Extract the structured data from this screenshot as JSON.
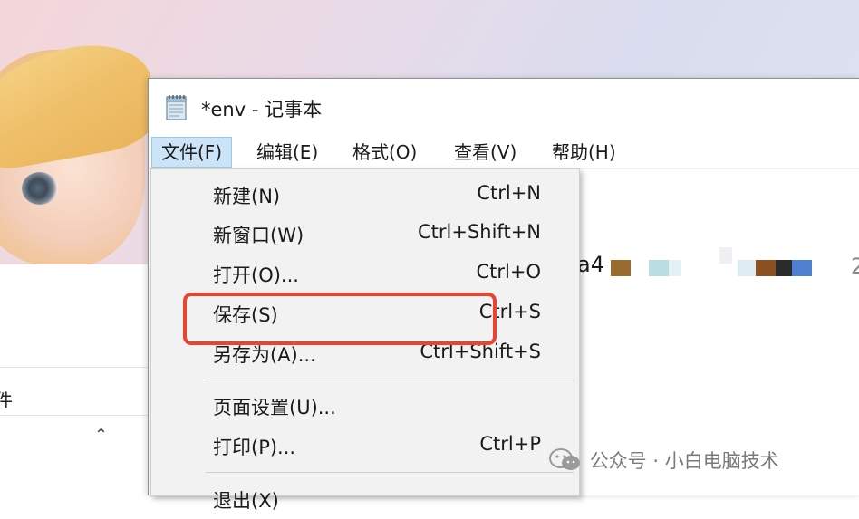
{
  "notepad": {
    "title": "*env - 记事本",
    "icon": "notepad-icon"
  },
  "menubar": {
    "items": [
      "文件(F)",
      "编辑(E)",
      "格式(O)",
      "查看(V)",
      "帮助(H)"
    ],
    "active": "文件(F)"
  },
  "file_menu": {
    "items": [
      {
        "label": "新建(N)",
        "shortcut": "Ctrl+N"
      },
      {
        "label": "新窗口(W)",
        "shortcut": "Ctrl+Shift+N"
      },
      {
        "label": "打开(O)...",
        "shortcut": "Ctrl+O"
      },
      {
        "label": "保存(S)",
        "shortcut": "Ctrl+S"
      },
      {
        "label": "另存为(A)...",
        "shortcut": "Ctrl+Shift+S"
      },
      {
        "label": "页面设置(U)...",
        "shortcut": ""
      },
      {
        "label": "打印(P)...",
        "shortcut": "Ctrl+P"
      },
      {
        "label": "退出(X)",
        "shortcut": ""
      }
    ],
    "highlighted_item": "保存(S)"
  },
  "editor": {
    "visible_text": "a4"
  },
  "explorer_behind": {
    "address_fragment": "件",
    "chevron_icon": "chevron-up-icon"
  },
  "watermark": {
    "text": "公众号 · 小白电脑技术",
    "icon": "wechat-icon"
  },
  "colors": {
    "highlight_border": "#e8452e",
    "menu_active_bg": "#cce4f7",
    "dropdown_bg": "#f2f2f2"
  }
}
